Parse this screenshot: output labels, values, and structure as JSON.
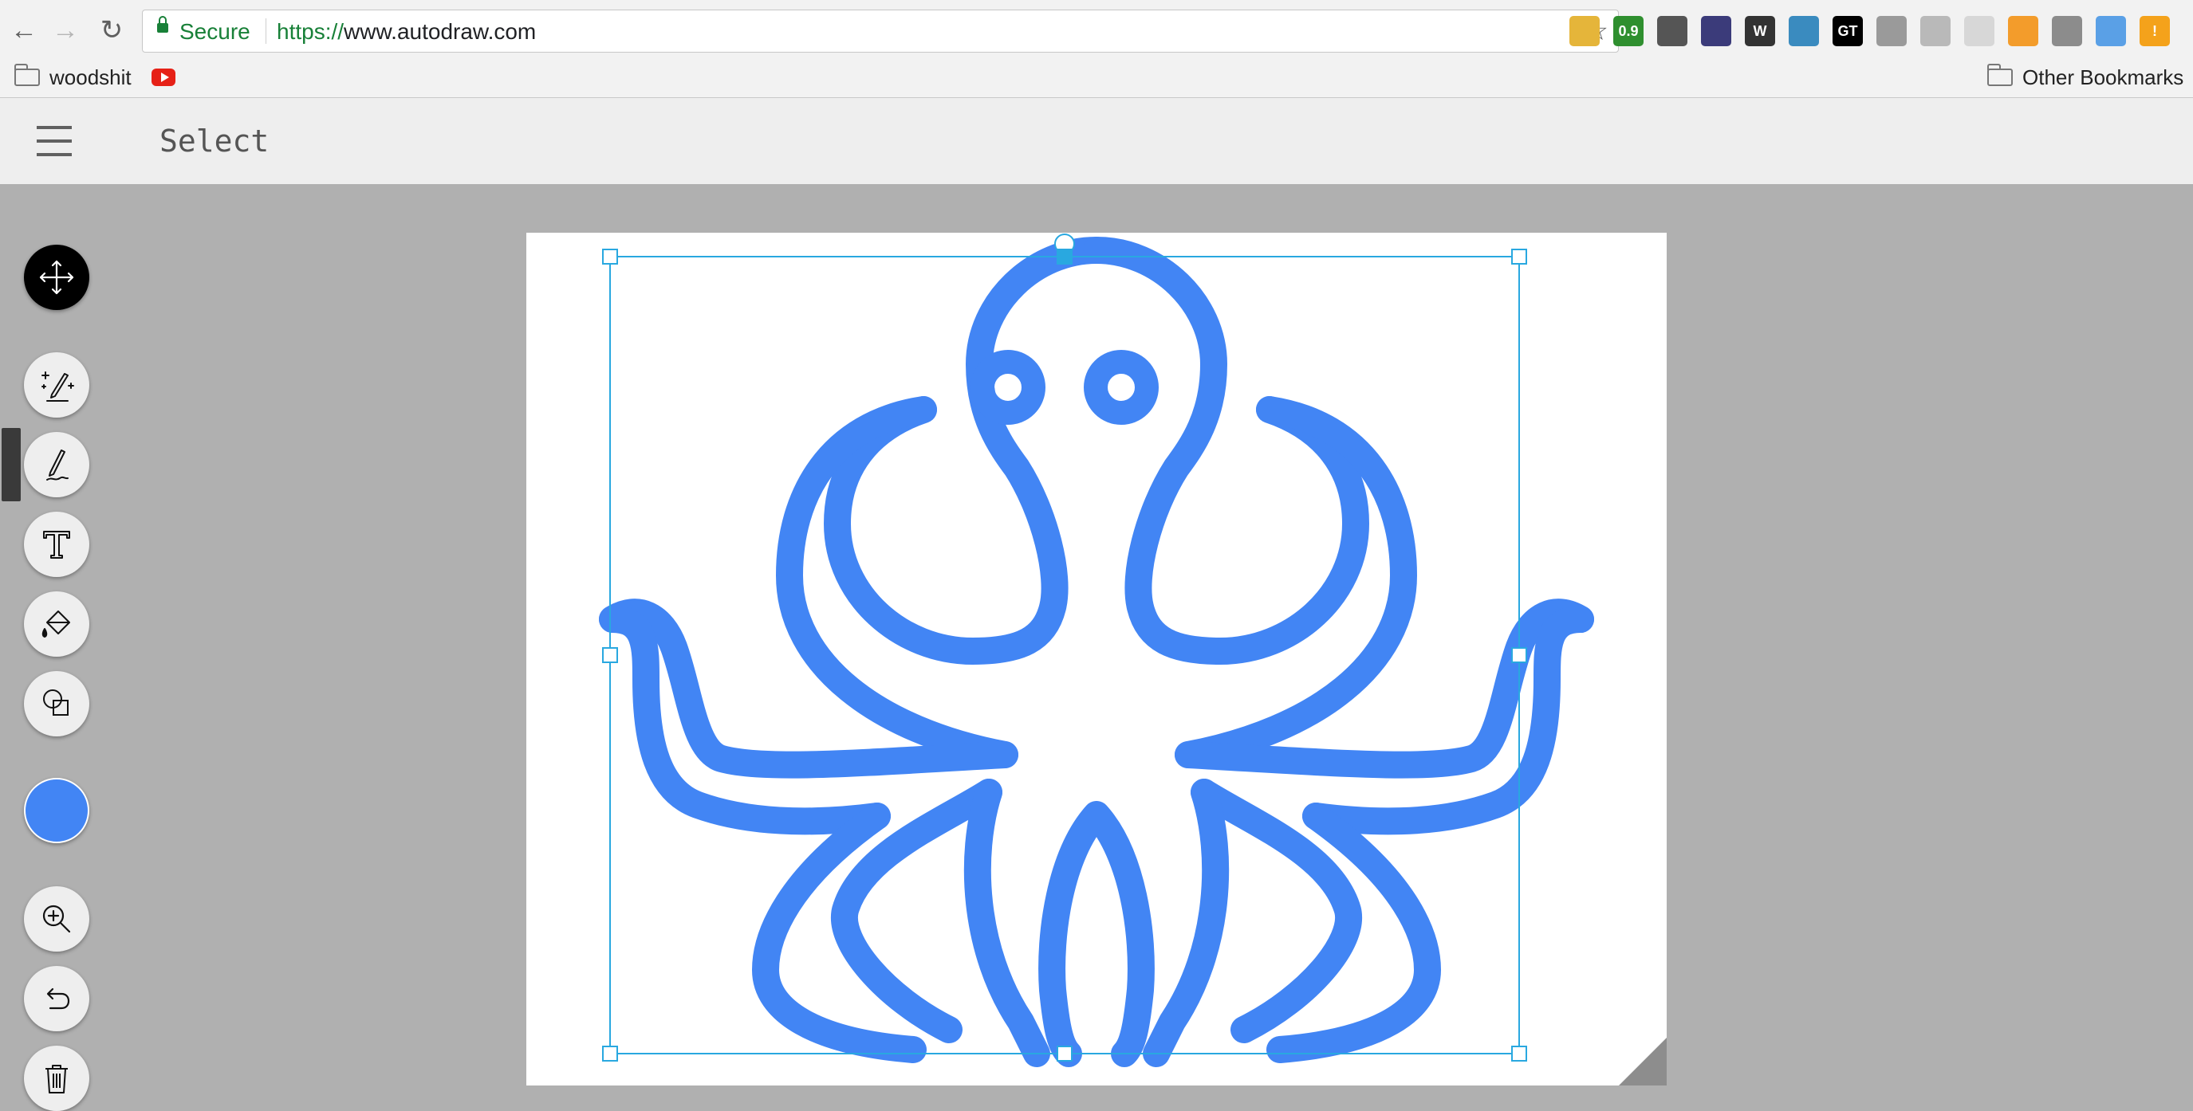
{
  "browser": {
    "secure_label": "Secure",
    "url_scheme": "https://",
    "url_host": "www.autodraw.com",
    "extensions": [
      {
        "name": "ruler-extension-icon",
        "color": "#e5b53a",
        "text": ""
      },
      {
        "name": "pagespeed-extension-icon",
        "color": "#2f8f2f",
        "text": "0.9"
      },
      {
        "name": "bug-extension-icon",
        "color": "#555555",
        "text": ""
      },
      {
        "name": "meter-extension-icon",
        "color": "#3b3b7a",
        "text": ""
      },
      {
        "name": "wappalyzer-extension-icon",
        "color": "#333333",
        "text": "W"
      },
      {
        "name": "wave-extension-icon",
        "color": "#3a8bbf",
        "text": ""
      },
      {
        "name": "gtmetrix-extension-icon",
        "color": "#000000",
        "text": "GT"
      },
      {
        "name": "magnet-extension-icon",
        "color": "#9a9a9a",
        "text": ""
      },
      {
        "name": "columns-extension-icon",
        "color": "#b9b9b9",
        "text": ""
      },
      {
        "name": "circle-extension-icon",
        "color": "#d7d7d7",
        "text": ""
      },
      {
        "name": "chart-extension-icon",
        "color": "#f39c2b",
        "text": ""
      },
      {
        "name": "shield-extension-icon",
        "color": "#8c8c8c",
        "text": ""
      },
      {
        "name": "lighthouse-extension-icon",
        "color": "#5aa0e6",
        "text": ""
      },
      {
        "name": "alert-extension-icon",
        "color": "#f4a21b",
        "text": "!"
      }
    ]
  },
  "bookmarks": {
    "items": [
      {
        "label": "woodshit",
        "icon": "folder-icon"
      },
      {
        "label": "",
        "icon": "youtube-icon"
      }
    ],
    "other_label": "Other Bookmarks"
  },
  "app": {
    "mode_title": "Select",
    "menu_icon": "hamburger-menu-icon",
    "tools": [
      {
        "name": "select-tool",
        "icon": "move-arrows-icon",
        "active": true
      },
      {
        "name": "autodraw-tool",
        "icon": "sparkle-pencil-icon",
        "active": false
      },
      {
        "name": "draw-tool",
        "icon": "pencil-icon",
        "active": false
      },
      {
        "name": "type-tool",
        "icon": "text-t-icon",
        "active": false
      },
      {
        "name": "fill-tool",
        "icon": "paint-bucket-icon",
        "active": false
      },
      {
        "name": "shape-tool",
        "icon": "shapes-icon",
        "active": false
      },
      {
        "name": "zoom-tool",
        "icon": "zoom-in-icon",
        "active": false
      },
      {
        "name": "undo-tool",
        "icon": "undo-icon",
        "active": false
      },
      {
        "name": "delete-tool",
        "icon": "trash-icon",
        "active": false
      }
    ],
    "current_color": "#4285f4",
    "drawing": {
      "subject": "octopus",
      "stroke_color": "#4285f4",
      "selection_color": "#29a8e0"
    }
  }
}
